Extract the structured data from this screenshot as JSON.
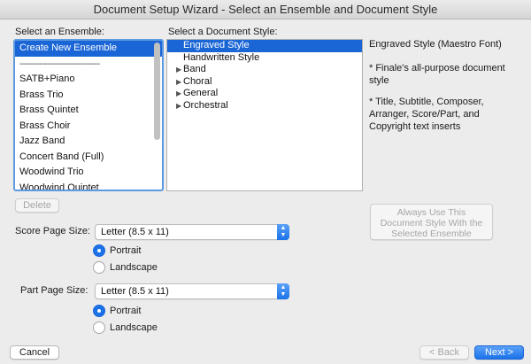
{
  "window": {
    "title": "Document Setup Wizard - Select an Ensemble and Document Style"
  },
  "ensemble": {
    "label": "Select an Ensemble:",
    "items": [
      "Create New Ensemble",
      "--------------------------------",
      "SATB+Piano",
      "Brass Trio",
      "Brass Quintet",
      "Brass Choir",
      "Jazz Band",
      "Concert Band (Full)",
      "Woodwind Trio",
      "Woodwind Quintet"
    ],
    "delete_label": "Delete"
  },
  "style": {
    "label": "Select a Document Style:",
    "items": [
      "Engraved Style",
      "Handwritten Style",
      "Band",
      "Choral",
      "General",
      "Orchestral"
    ],
    "tri": "▶"
  },
  "description": {
    "title": "Engraved Style (Maestro Font)",
    "line1": "* Finale's all-purpose document",
    "line2": "style",
    "line3": "* Title, Subtitle, Composer,",
    "line4": "Arranger, Score/Part, and",
    "line5": "Copyright text inserts"
  },
  "always_use": {
    "line1": "Always Use This",
    "line2": "Document Style With the",
    "line3": "Selected Ensemble"
  },
  "score": {
    "label": "Score Page Size:",
    "value": "Letter (8.5 x 11)",
    "portrait": "Portrait",
    "landscape": "Landscape",
    "orientation": "Portrait"
  },
  "part": {
    "label": "Part Page Size:",
    "value": "Letter (8.5 x 11)",
    "portrait": "Portrait",
    "landscape": "Landscape",
    "orientation": "Portrait"
  },
  "footer": {
    "cancel": "Cancel",
    "back": "< Back",
    "next": "Next >"
  },
  "icons": {
    "chevron": "▲▼",
    "select_chev_up": "▲",
    "select_chev_down": "▼"
  },
  "colors": {
    "selection": "#1b66d6",
    "accent": "#1b72e8"
  }
}
